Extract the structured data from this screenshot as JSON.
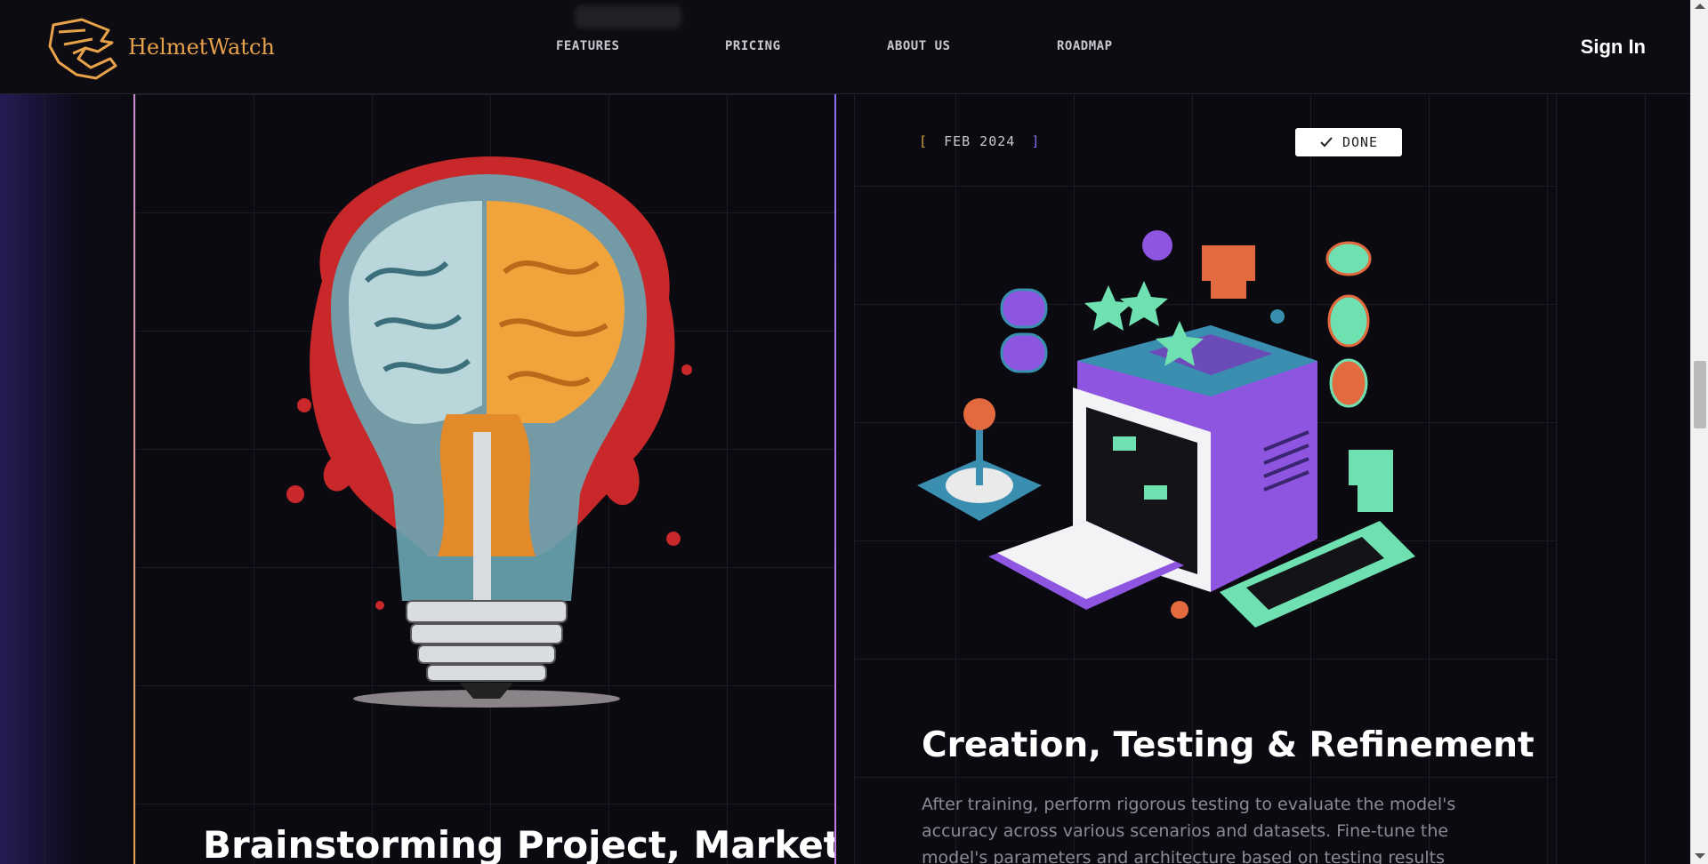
{
  "header": {
    "brand": "HelmetWatch",
    "nav": [
      "FEATURES",
      "PRICING",
      "ABOUT US",
      "ROADMAP"
    ],
    "sign_in": "Sign In"
  },
  "left_card": {
    "title": "Brainstorming Project, Market,",
    "image": "brain-lightbulb-illustration"
  },
  "right_card": {
    "date_open": "[",
    "date": "FEB 2024",
    "date_close": "]",
    "status": "DONE",
    "status_icon": "check-icon",
    "image": "isometric-arcade-computer-illustration",
    "title": "Creation, Testing & Refinement",
    "description": "After training, perform rigorous testing to evaluate the model's accuracy across various scenarios and datasets. Fine-tune the model's parameters and architecture based on testing results"
  },
  "colors": {
    "brand": "#e8a24a",
    "accent_purple": "#8c6ff0",
    "background": "#0b0a10"
  }
}
